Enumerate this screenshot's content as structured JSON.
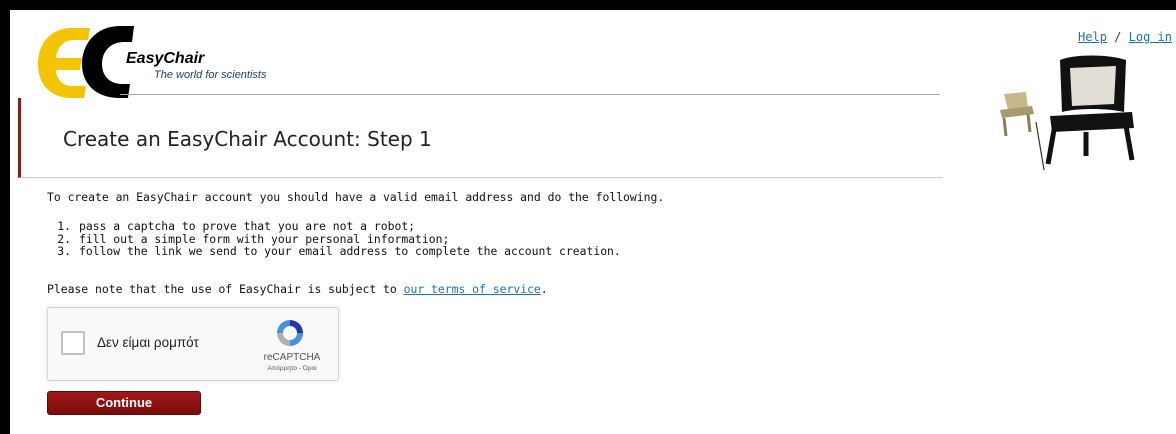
{
  "header": {
    "logo_name": "EasyChair",
    "logo_tagline": "The world for scientists",
    "links": {
      "help": "Help",
      "separator": "/",
      "login": "Log in"
    }
  },
  "page": {
    "title": "Create an EasyChair Account: Step 1",
    "intro": "To create an EasyChair account you should have a valid email address and do the following.",
    "steps": [
      {
        "num": "1.",
        "text": "pass a captcha to prove that you are not a robot;"
      },
      {
        "num": "2.",
        "text": "fill out a simple form with your personal information;"
      },
      {
        "num": "3.",
        "text": "follow the link we send to your email address to complete the account creation."
      }
    ],
    "note_prefix": "Please note that the use of EasyChair is subject to ",
    "terms_link": "our terms of service",
    "note_suffix": "."
  },
  "recaptcha": {
    "label": "Δεν είμαι ρομπότ",
    "brand": "reCAPTCHA",
    "terms": "Απόρρητο - Όροι"
  },
  "actions": {
    "continue_label": "Continue"
  },
  "colors": {
    "accent_red": "#8b1a1a",
    "link_blue": "#1a73b8",
    "logo_yellow": "#f5c400"
  }
}
